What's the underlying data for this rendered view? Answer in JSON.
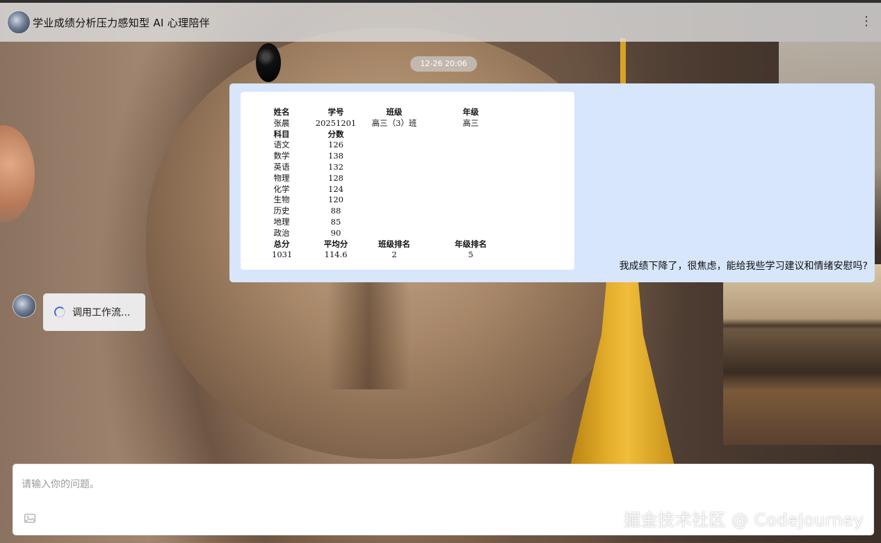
{
  "header": {
    "title": "学业成绩分析压力感知型 AI 心理陪伴",
    "menu_icon": "⋮"
  },
  "chat": {
    "timestamp": "12-26 20:06",
    "user_message": {
      "text": "我成绩下降了，很焦虑，能给我些学习建议和情绪安慰吗?",
      "score_sheet": {
        "rows": [
          {
            "cells": [
              "姓名",
              "学号",
              "班级",
              "年级"
            ],
            "bold": true
          },
          {
            "cells": [
              "张晨",
              "20251201",
              "高三（3）班",
              "高三"
            ],
            "bold": false
          },
          {
            "cells": [
              "科目",
              "分数",
              "",
              ""
            ],
            "bold": true
          },
          {
            "cells": [
              "语文",
              "126",
              "",
              ""
            ],
            "bold": false
          },
          {
            "cells": [
              "数学",
              "138",
              "",
              ""
            ],
            "bold": false
          },
          {
            "cells": [
              "英语",
              "132",
              "",
              ""
            ],
            "bold": false
          },
          {
            "cells": [
              "物理",
              "128",
              "",
              ""
            ],
            "bold": false
          },
          {
            "cells": [
              "化学",
              "124",
              "",
              ""
            ],
            "bold": false
          },
          {
            "cells": [
              "生物",
              "120",
              "",
              ""
            ],
            "bold": false
          },
          {
            "cells": [
              "历史",
              "88",
              "",
              ""
            ],
            "bold": false
          },
          {
            "cells": [
              "地理",
              "85",
              "",
              ""
            ],
            "bold": false
          },
          {
            "cells": [
              "政治",
              "90",
              "",
              ""
            ],
            "bold": false
          },
          {
            "cells": [
              "总分",
              "平均分",
              "班级排名",
              "年级排名"
            ],
            "bold": true
          },
          {
            "cells": [
              "1031",
              "114.6",
              "2",
              "5"
            ],
            "bold": false
          }
        ]
      }
    },
    "bot_message": {
      "status_text": "调用工作流..."
    }
  },
  "input": {
    "placeholder": "请输入你的问题。",
    "value": "",
    "image_icon": "image-icon"
  },
  "watermark": "掘金技术社区 @ CodeJourney",
  "colors": {
    "user_bubble": "#d7e6fb",
    "spinner_accent": "#3b6fd8",
    "header_bg": "#dcdcdc"
  }
}
